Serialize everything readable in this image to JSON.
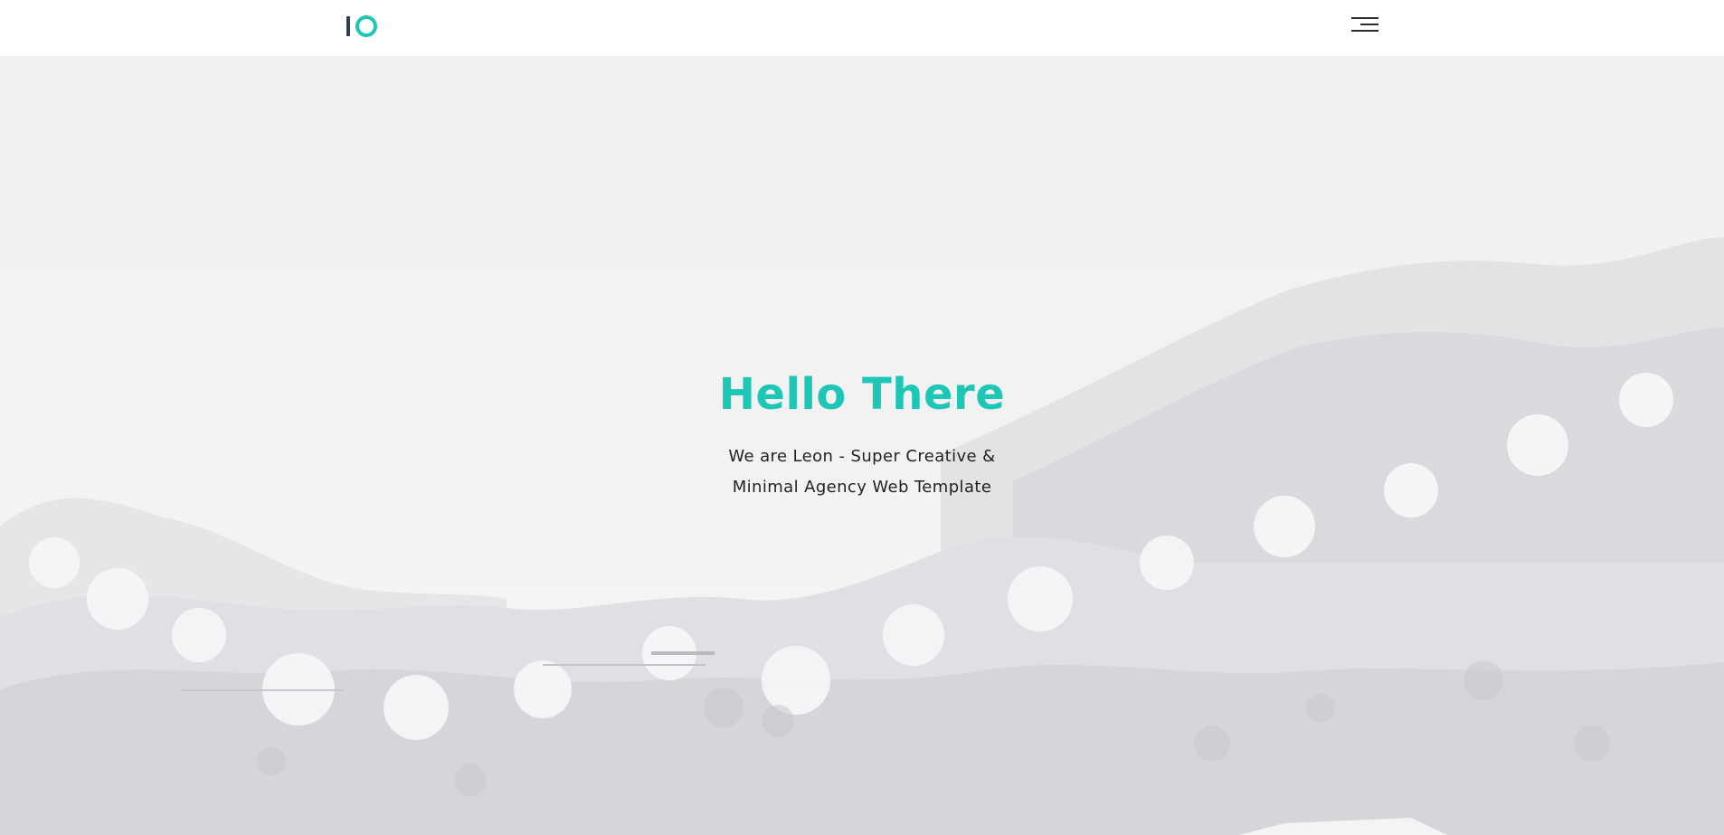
{
  "header": {
    "logo_icon": "io-logo",
    "menu_icon": "hamburger-menu-icon"
  },
  "hero": {
    "title": "Hello There",
    "subtitle": "We are Leon - Super Creative & Minimal Agency Web Template",
    "background": "snowy-forest-photo"
  },
  "colors": {
    "accent": "#1ec6b6",
    "text": "#222222",
    "logo_dark": "#2c3e50"
  }
}
